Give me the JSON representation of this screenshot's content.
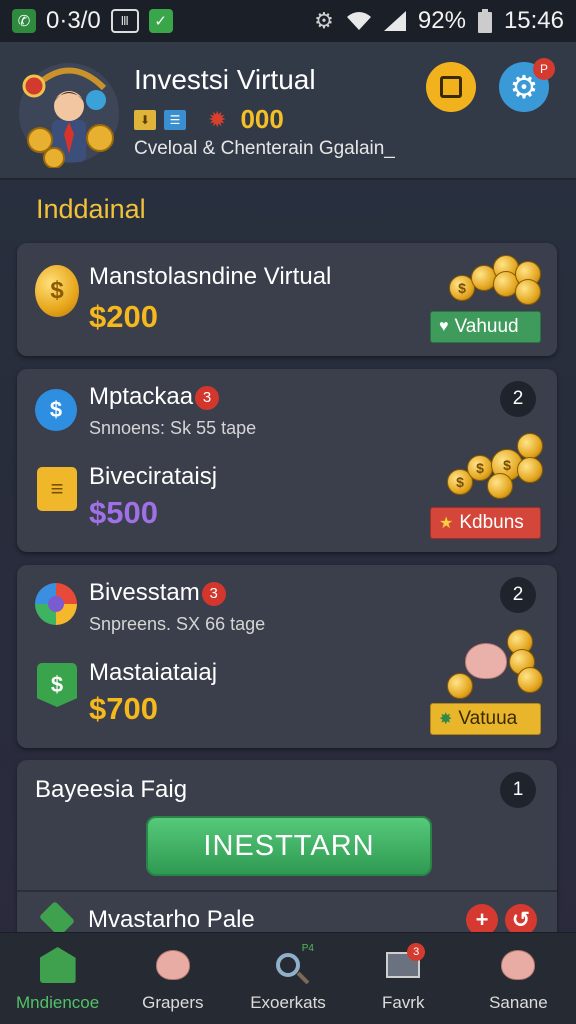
{
  "status_bar": {
    "left_text": "0·3/0",
    "box_text": "Ⅲ",
    "battery": "92%",
    "time": "15:46"
  },
  "header": {
    "title": "Investsi Virtual",
    "coin_count": "000",
    "subtitle": "Cveloal & Chenterain Ggalain_",
    "settings_badge": "P"
  },
  "section_title": "Inddainal",
  "cards": [
    {
      "title": "Manstolasndine Virtual",
      "amount": "$200",
      "action_label": "Vahuud"
    },
    {
      "title": "Mptackaa",
      "badge": "3",
      "count": "2",
      "desc": "Snnoens: Sk 55 tape",
      "title2": "Bivecirataisj",
      "amount": "$500",
      "action_label": "Kdbuns"
    },
    {
      "title": "Bivesstam",
      "badge": "3",
      "count": "2",
      "desc": "Snpreens. SX 66 tage",
      "title2": "Mastaiataiaj",
      "amount": "$700",
      "action_label": "Vatuua"
    },
    {
      "title": "Bayeesia Faig",
      "count": "1",
      "button_label": "INESTTARN",
      "row_label": "Mvastarho Pale"
    }
  ],
  "bottom_nav": [
    {
      "label": "Mndiencoe",
      "icon": "home-icon",
      "active": true
    },
    {
      "label": "Grapers",
      "icon": "piggy-bank-icon",
      "active": false
    },
    {
      "label": "Exoerkats",
      "icon": "magnifier-icon",
      "active": false,
      "tag": "P4"
    },
    {
      "label": "Favrk",
      "icon": "mail-icon",
      "active": false,
      "badge": "3"
    },
    {
      "label": "Sanane",
      "icon": "piggy-bank-icon",
      "active": false
    }
  ]
}
